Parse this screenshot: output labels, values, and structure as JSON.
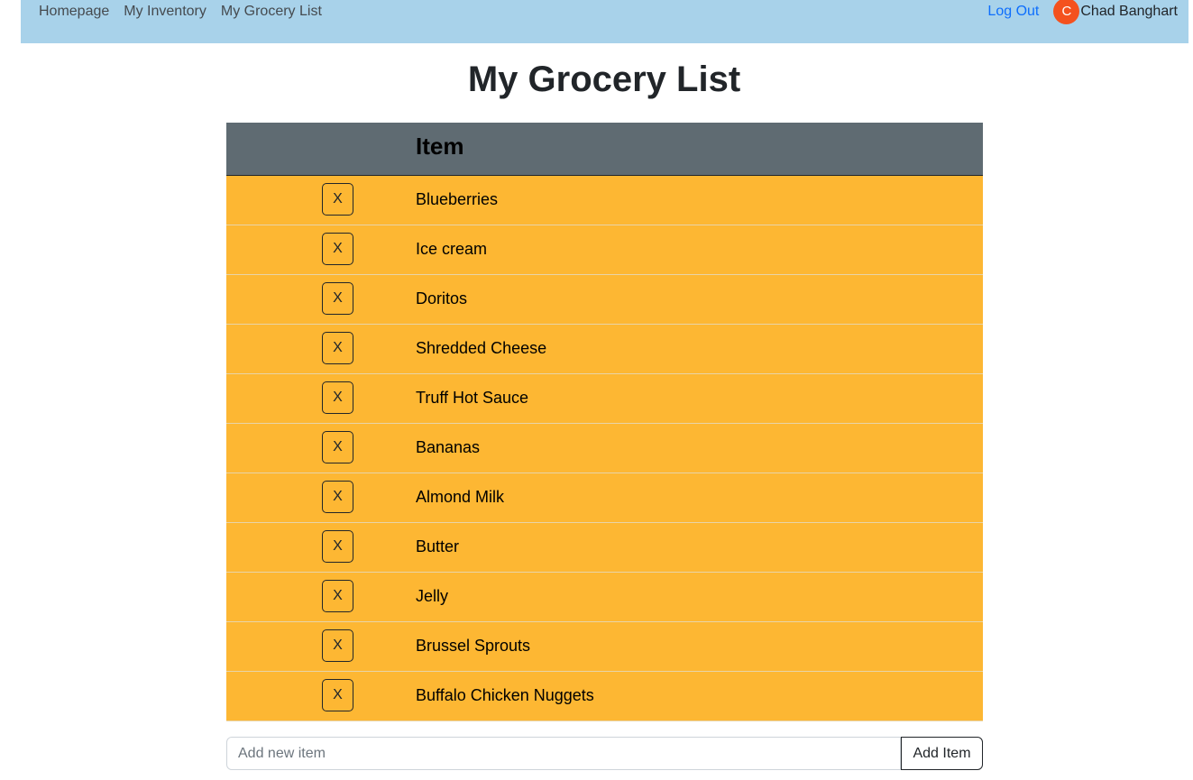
{
  "nav": {
    "links": [
      "Homepage",
      "My Inventory",
      "My Grocery List"
    ],
    "logout_label": "Log Out",
    "avatar_initial": "C",
    "user_name": "Chad Banghart"
  },
  "page": {
    "title": "My Grocery List"
  },
  "table": {
    "header_item": "Item",
    "delete_label": "X",
    "items": [
      "Blueberries",
      "Ice cream",
      "Doritos",
      "Shredded Cheese",
      "Truff Hot Sauce",
      "Bananas",
      "Almond Milk",
      "Butter",
      "Jelly",
      "Brussel Sprouts",
      "Buffalo Chicken Nuggets"
    ]
  },
  "add_form": {
    "placeholder": "Add new item",
    "value": "",
    "button_label": "Add Item"
  },
  "colors": {
    "navbar": "#a8d2ea",
    "table_header": "#5f6b72",
    "row_background": "#fdb733",
    "avatar": "#f4511e",
    "logout_link": "#0d6efd"
  }
}
